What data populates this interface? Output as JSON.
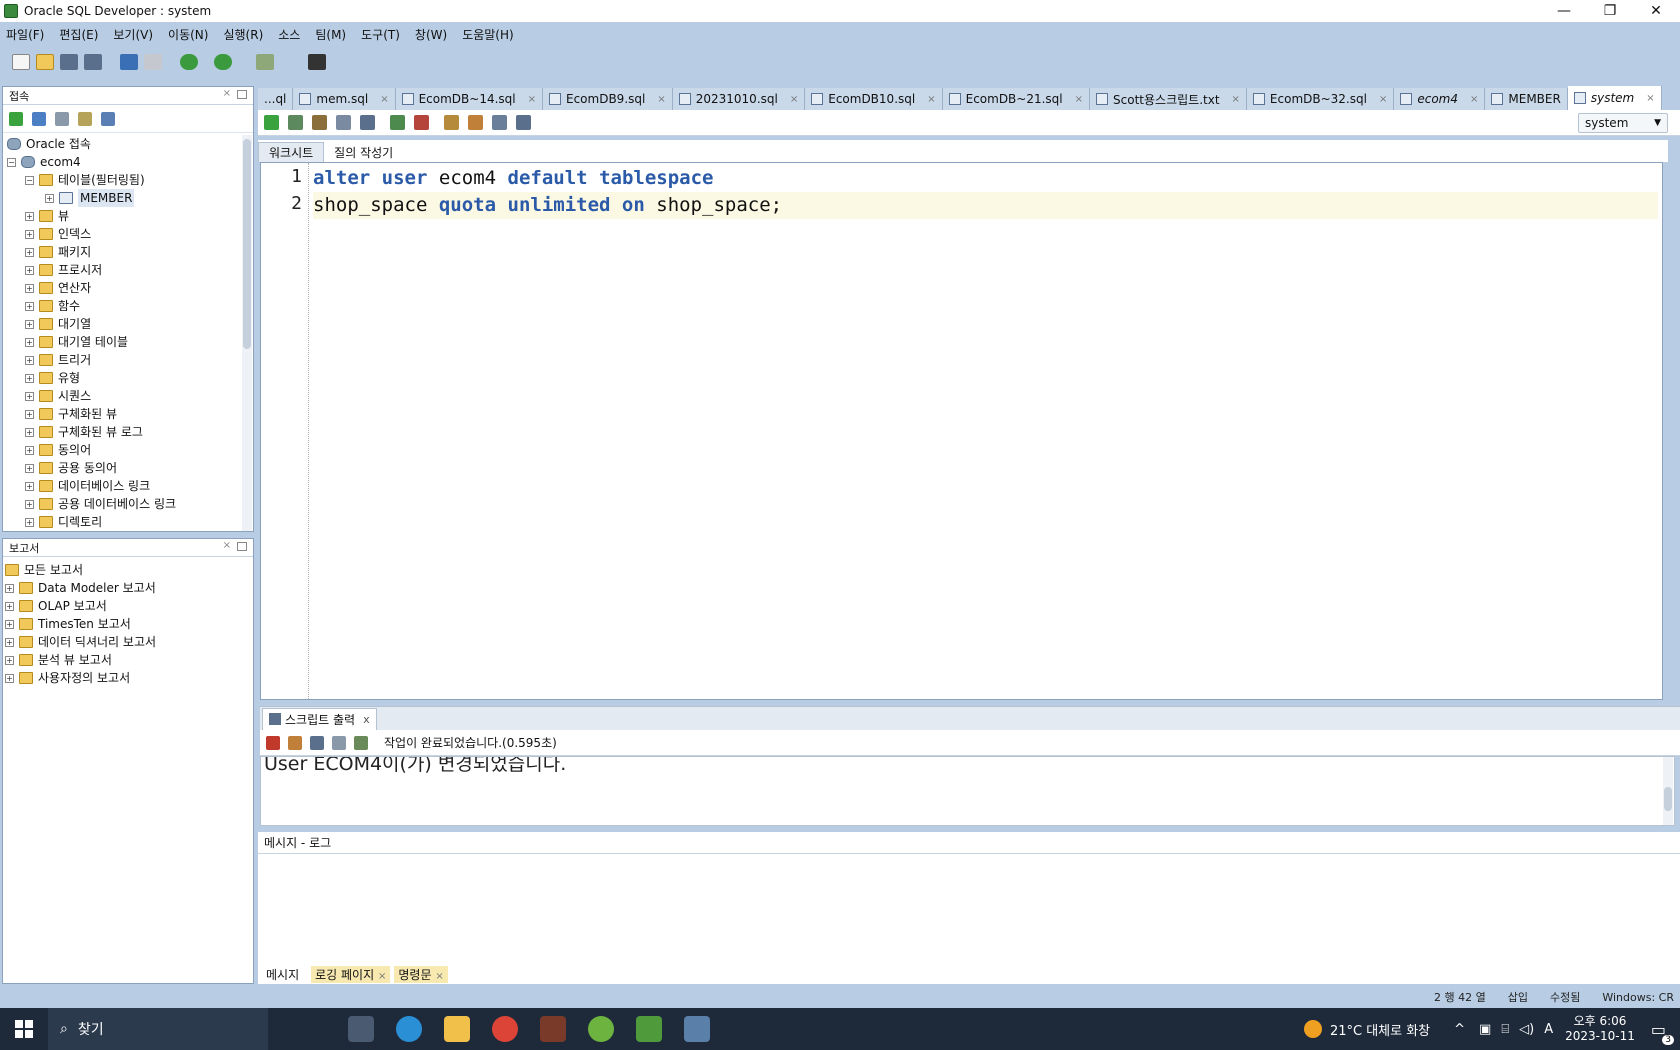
{
  "window": {
    "title": "Oracle SQL Developer : system",
    "minimize": "—",
    "maximize": "❐",
    "close": "✕"
  },
  "menu": [
    "파일(F)",
    "편집(E)",
    "보기(V)",
    "이동(N)",
    "실행(R)",
    "소스",
    "팀(M)",
    "도구(T)",
    "창(W)",
    "도움말(H)"
  ],
  "connections_panel": {
    "title": "접속",
    "close": "×",
    "root": "Oracle 접속",
    "connection": "ecom4",
    "tables_node": "테이블(필터링됨)",
    "table_member": "MEMBER",
    "nodes": [
      "뷰",
      "인덱스",
      "패키지",
      "프로시저",
      "연산자",
      "함수",
      "대기열",
      "대기열 테이블",
      "트리거",
      "유형",
      "시퀀스",
      "구체화된 뷰",
      "구체화된 뷰 로그",
      "동의어",
      "공용 동의어",
      "데이터베이스 링크",
      "공용 데이터베이스 링크",
      "디렉토리"
    ]
  },
  "reports_panel": {
    "title": "보고서",
    "close": "×",
    "root": "모든 보고서",
    "nodes": [
      "Data Modeler 보고서",
      "OLAP 보고서",
      "TimesTen 보고서",
      "데이터 딕셔너리 보고서",
      "분석 뷰 보고서",
      "사용자정의 보고서"
    ]
  },
  "editor_tabs": [
    "...ql",
    "mem.sql",
    "EcomDB~14.sql",
    "EcomDB9.sql",
    "20231010.sql",
    "EcomDB10.sql",
    "EcomDB~21.sql",
    "Scott용스크립트.txt",
    "EcomDB~32.sql",
    "ecom4",
    "MEMBER",
    "system"
  ],
  "tab_close": "×",
  "connection_selector": "system",
  "sub_tabs": [
    "워크시트",
    "질의 작성기"
  ],
  "code": {
    "line1_num": "1",
    "line2_num": "2",
    "l1_kw1": "alter",
    "l1_kw2": "user",
    "l1_t1": "ecom4",
    "l1_kw3": "default",
    "l1_kw4": "tablespace",
    "l2_t1": "shop_space",
    "l2_kw1": "quota",
    "l2_kw2": "unlimited",
    "l2_kw3": "on",
    "l2_t2": "shop_space;"
  },
  "output": {
    "tab": "스크립트 출력",
    "tab_close": "x",
    "status": "작업이 완료되었습니다.(0.595초)",
    "text": "User ECOM4이(가) 변경되었습니다."
  },
  "log": {
    "title": "메시지 - 로그",
    "tabs": [
      "메시지",
      "로깅 페이지",
      "명령문"
    ]
  },
  "statusbar": {
    "position": "2 행 42 열",
    "mode": "삽입",
    "modified": "수정됨",
    "platform": "Windows: CR"
  },
  "taskbar": {
    "search": "찾기",
    "weather": "21°C  대체로 화창",
    "time": "오후 6:06",
    "date": "2023-10-11",
    "notification_count": "3"
  },
  "colors": {
    "keyword": "#2a5aa8",
    "background": "#b8cde3",
    "taskbar": "#1e2a3a"
  }
}
